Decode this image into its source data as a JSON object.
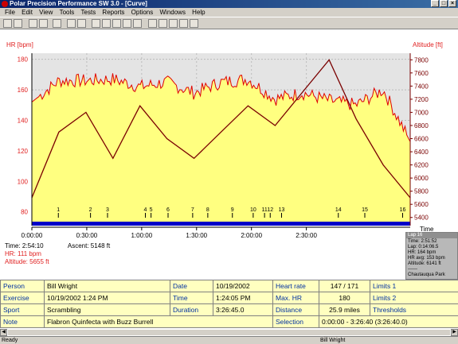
{
  "window": {
    "title": "Polar Precision Performance SW 3.0 - [Curve]"
  },
  "menu": [
    "File",
    "Edit",
    "View",
    "Tools",
    "Tests",
    "Reports",
    "Options",
    "Windows",
    "Help"
  ],
  "chart": {
    "left_axis_title": "HR [bpm]",
    "right_axis_title": "Altitude [ft]",
    "x_axis_title": "Time",
    "hr_ticks": [
      "180",
      "160",
      "140",
      "120",
      "100",
      "80"
    ],
    "alt_ticks": [
      "7800",
      "7600",
      "7400",
      "7200",
      "7000",
      "6800",
      "6600",
      "6400",
      "6200",
      "6000",
      "5800",
      "5600",
      "5400"
    ],
    "time_ticks": [
      "0:00:00",
      "0:30:00",
      "1:00:00",
      "1:30:00",
      "2:00:00",
      "2:30:00"
    ],
    "lap_markers": [
      "1",
      "2",
      "3",
      "4",
      "5",
      "6",
      "7",
      "8",
      "9",
      "10",
      "11",
      "12",
      "13",
      "14",
      "15",
      "16"
    ]
  },
  "chart_data": {
    "type": "line",
    "x": [
      "0:00",
      "0:15",
      "0:30",
      "0:45",
      "1:00",
      "1:15",
      "1:30",
      "1:45",
      "2:00",
      "2:15",
      "2:30",
      "2:45",
      "3:00",
      "3:15",
      "3:26"
    ],
    "series": [
      {
        "name": "HR",
        "axis": "left",
        "color": "#e00000",
        "values": [
          152,
          166,
          166,
          167,
          162,
          165,
          158,
          165,
          167,
          154,
          158,
          153,
          150,
          160,
          126
        ]
      },
      {
        "name": "Altitude",
        "axis": "right",
        "color": "#7a0000",
        "values": [
          5700,
          6700,
          7000,
          6300,
          7100,
          6600,
          6300,
          6700,
          7100,
          6800,
          7300,
          7800,
          6900,
          6200,
          5700
        ]
      }
    ],
    "ylim_left": [
      72,
      184
    ],
    "ylim_right": [
      5300,
      7900
    ],
    "xlim": [
      "0:00:00",
      "3:26:45"
    ],
    "grid": true,
    "type_note": "HR filled area + altitude line, dual axis"
  },
  "cursor_info": {
    "time_label": "Time: 2:54:10",
    "hr_label": "HR: 111 bpm",
    "alt_label": "Altitude: 5655 ft",
    "ascent_label": "Ascent: 5148 ft"
  },
  "lap_panel": {
    "header": "Lap 16",
    "lines": [
      "Time: 2:51:52",
      "Lap: 0:14:06.5",
      "HR: 164 bpm",
      "HR avg: 153 bpm",
      "Altitude: 6141 ft",
      "------",
      "Chautauqua Park"
    ]
  },
  "table": {
    "rows": [
      {
        "k1": "Person",
        "v1": "Bill Wright",
        "k2": "Date",
        "v2": "10/19/2002",
        "k3": "Heart rate",
        "v3": "147 / 171",
        "k4": "Limits 1"
      },
      {
        "k1": "Exercise",
        "v1": "10/19/2002 1:24 PM",
        "k2": "Time",
        "v2": "1:24:05 PM",
        "k3": "Max. HR",
        "v3": "180",
        "k4": "Limits 2"
      },
      {
        "k1": "Sport",
        "v1": "Scrambling",
        "k2": "Duration",
        "v2": "3:26:45.0",
        "k3": "Distance",
        "v3": "25.9 miles",
        "k4": "Thresholds"
      }
    ],
    "note_label": "Note",
    "note_value": "Flabron Quinfecta with Buzz Burrell",
    "selection_label": "Selection",
    "selection_value": "0:00:00 - 3:26:40 (3:26:40.0)"
  },
  "status": {
    "left": "Ready",
    "user": "Bill Wright"
  }
}
